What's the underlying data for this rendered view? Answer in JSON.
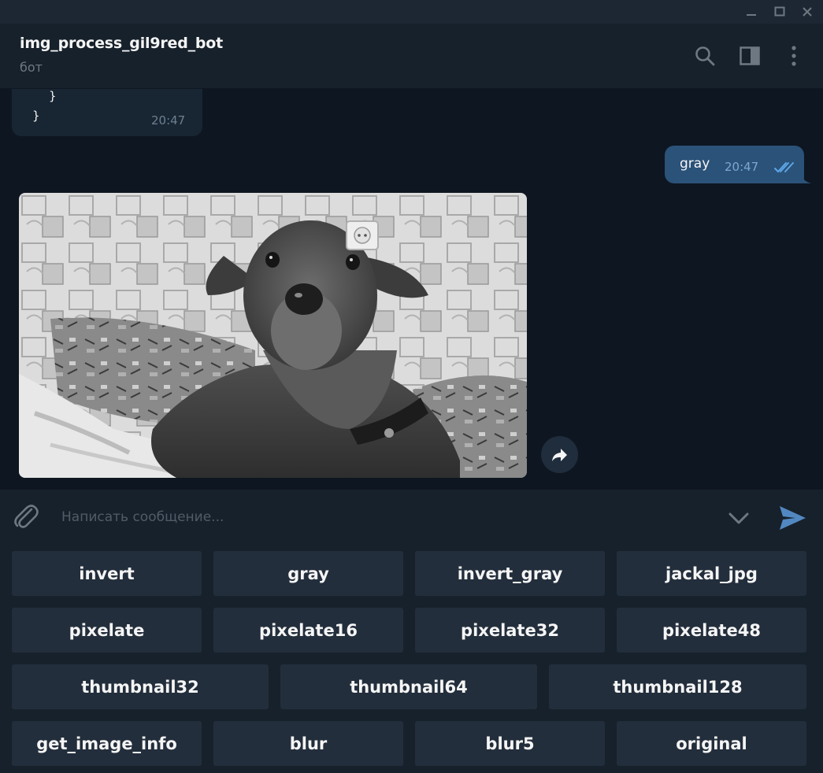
{
  "chat": {
    "name": "img_process_gil9red_bot",
    "status": "бот"
  },
  "messages": {
    "incoming_code_lines": [
      "}",
      "}"
    ],
    "incoming_time": "20:47",
    "outgoing_text": "gray",
    "outgoing_time": "20:47",
    "photo_description": "grayscale dog photo"
  },
  "composer": {
    "placeholder": "Написать сообщение..."
  },
  "keyboard": {
    "row1": [
      "invert",
      "gray",
      "invert_gray",
      "jackal_jpg"
    ],
    "row2": [
      "pixelate",
      "pixelate16",
      "pixelate32",
      "pixelate48"
    ],
    "row3": [
      "thumbnail32",
      "thumbnail64",
      "thumbnail128"
    ],
    "row4": [
      "get_image_info",
      "blur",
      "blur5",
      "original"
    ]
  },
  "colors": {
    "accent": "#5288c1",
    "bubble_out": "#2b5278",
    "bubble_in": "#182533",
    "button_bg": "#232e3c",
    "chat_bg": "#0e1621"
  },
  "icons": [
    "minimize-icon",
    "maximize-icon",
    "close-icon",
    "search-icon",
    "sidebar-toggle-icon",
    "more-vertical-icon",
    "share-icon",
    "attach-icon",
    "chevron-down-icon",
    "send-icon",
    "double-check-icon"
  ]
}
